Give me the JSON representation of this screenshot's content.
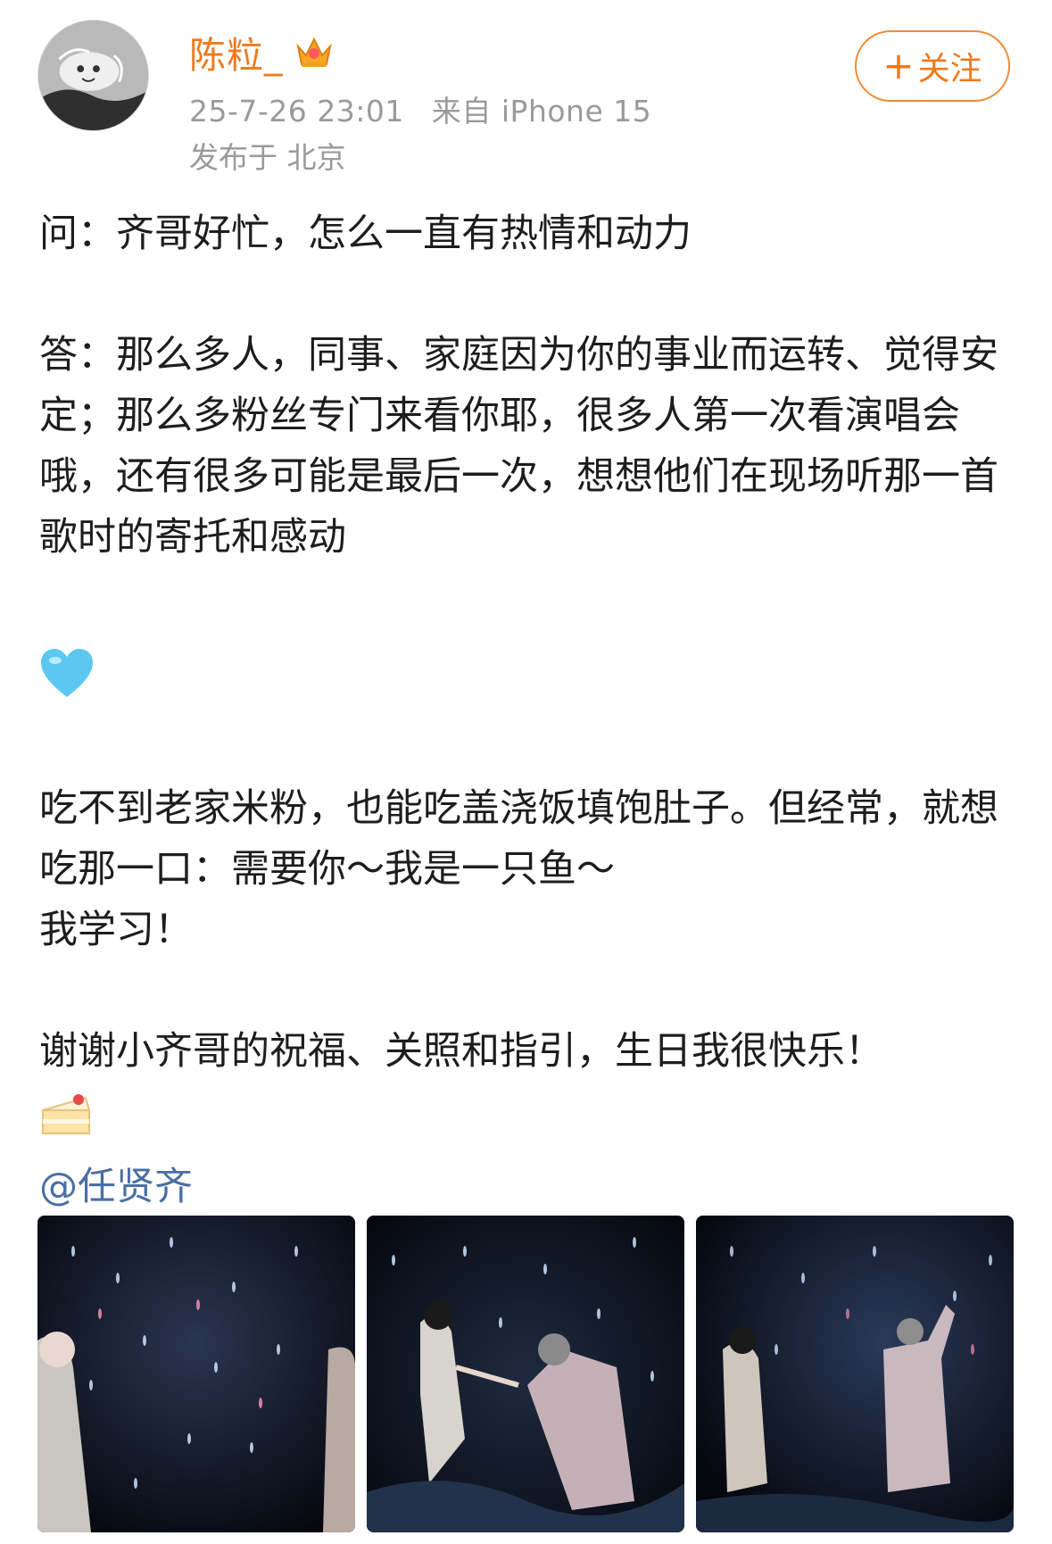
{
  "user": {
    "name": "陈粒_",
    "badge_icon": "crown-icon",
    "avatar_icon": "avatar-image"
  },
  "meta": {
    "timestamp": "25-7-26 23:01",
    "source": "来自 iPhone 15",
    "location": "发布于 北京"
  },
  "follow": {
    "plus": "+",
    "label": "关注"
  },
  "post": {
    "question": "问：齐哥好忙，怎么一直有热情和动力",
    "answer": "答：那么多人，同事、家庭因为你的事业而运转、觉得安定；那么多粉丝专门来看你耶，很多人第一次看演唱会哦，还有很多可能是最后一次，想想他们在现场听那一首歌时的寄托和感动",
    "emoji_1": "blue-heart",
    "line_1": "吃不到老家米粉，也能吃盖浇饭填饱肚子。但经常，就想吃那一口：需要你～我是一只鱼～",
    "line_2": "我学习！",
    "thanks": "谢谢小齐哥的祝福、关照和指引，生日我很快乐！",
    "emoji_2": "cake",
    "mention": "@任贤齐"
  },
  "photos": [
    {
      "icon": "concert-photo-1"
    },
    {
      "icon": "concert-photo-2"
    },
    {
      "icon": "concert-photo-3"
    }
  ],
  "colors": {
    "username": "#f07a1d",
    "meta": "#9a9a9a",
    "mention": "#4a6ea3",
    "follow_border": "#f08a33",
    "text": "#1d1d1d"
  }
}
